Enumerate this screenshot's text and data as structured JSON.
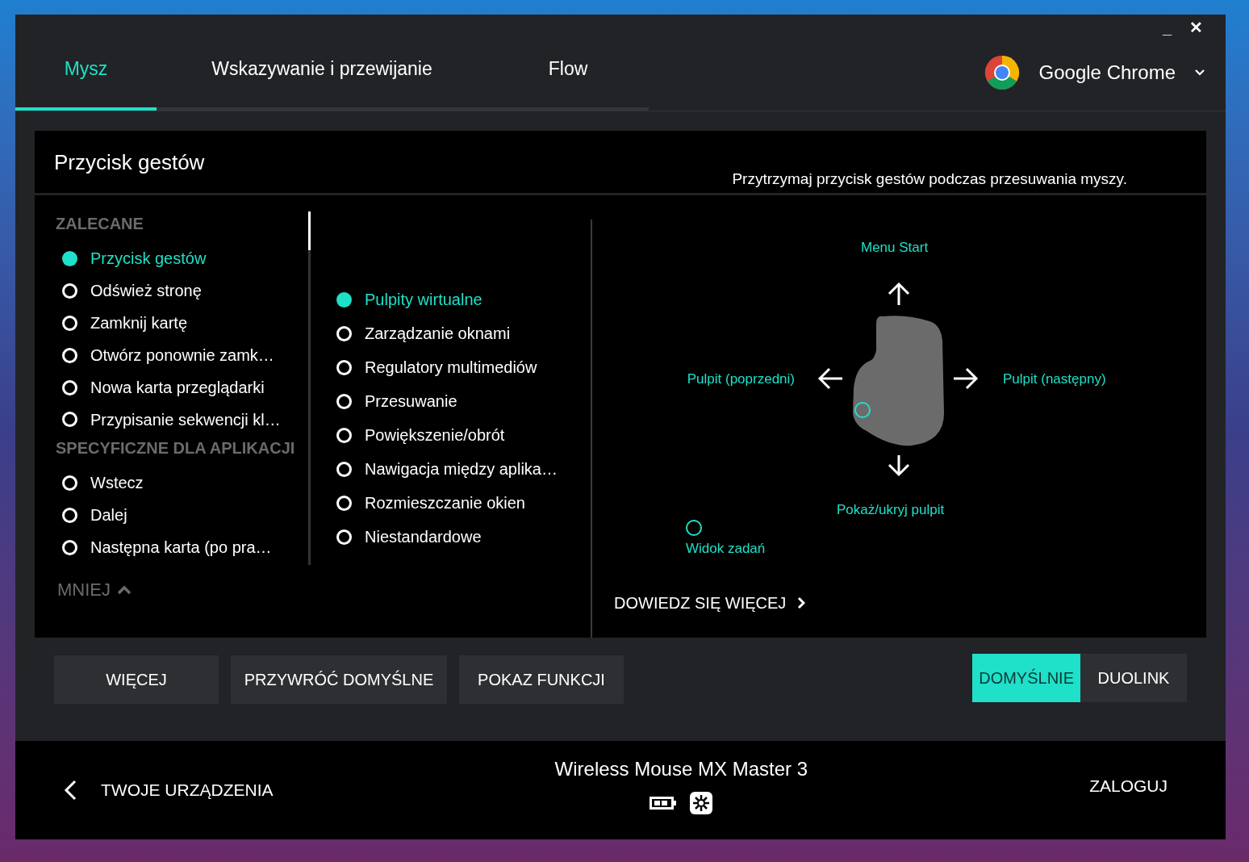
{
  "window": {
    "minimize": "_",
    "close": "✕"
  },
  "tabs": [
    {
      "label": "Mysz",
      "selected": true
    },
    {
      "label": "Wskazywanie i przewijanie",
      "selected": false
    },
    {
      "label": "Flow",
      "selected": false
    }
  ],
  "app_selector": {
    "label": "Google Chrome"
  },
  "panel": {
    "title": "Przycisk gestów",
    "hint": "Przytrzymaj przycisk gestów podczas przesuwania myszy."
  },
  "action_list": {
    "sections": [
      {
        "heading": "ZALECANE",
        "items": [
          {
            "label": "Przycisk gestów",
            "selected": true
          },
          {
            "label": "Odśwież stronę",
            "selected": false
          },
          {
            "label": "Zamknij kartę",
            "selected": false
          },
          {
            "label": "Otwórz ponownie zamk…",
            "selected": false
          },
          {
            "label": "Nowa karta przeglądarki",
            "selected": false
          },
          {
            "label": "Przypisanie sekwencji kl…",
            "selected": false
          }
        ]
      },
      {
        "heading": "SPECYFICZNE DLA APLIKACJI",
        "items": [
          {
            "label": "Wstecz",
            "selected": false
          },
          {
            "label": "Dalej",
            "selected": false
          },
          {
            "label": "Następna karta (po pra…",
            "selected": false
          }
        ]
      }
    ],
    "less_link": "MNIEJ"
  },
  "gesture_list": [
    {
      "label": "Pulpity wirtualne",
      "selected": true
    },
    {
      "label": "Zarządzanie oknami",
      "selected": false
    },
    {
      "label": "Regulatory multimediów",
      "selected": false
    },
    {
      "label": "Przesuwanie",
      "selected": false
    },
    {
      "label": "Powiększenie/obrót",
      "selected": false
    },
    {
      "label": "Nawigacja między aplika…",
      "selected": false
    },
    {
      "label": "Rozmieszczanie okien",
      "selected": false
    },
    {
      "label": "Niestandardowe",
      "selected": false
    }
  ],
  "diagram": {
    "up": "Menu Start",
    "left": "Pulpit (poprzedni)",
    "right": "Pulpit (następny)",
    "down": "Pokaż/ukryj pulpit",
    "click": "Widok zadań"
  },
  "learn_more": "DOWIEDZ SIĘ WIĘCEJ",
  "buttons": [
    "WIĘCEJ",
    "PRZYWRÓĆ DOMYŚLNE",
    "POKAZ FUNKCJI"
  ],
  "mode_toggle": [
    {
      "label": "DOMYŚLNIE",
      "selected": true
    },
    {
      "label": "DUOLINK",
      "selected": false
    }
  ],
  "footer": {
    "back": "TWOJE URZĄDZENIA",
    "device": "Wireless Mouse MX Master 3",
    "login": "ZALOGUJ"
  }
}
